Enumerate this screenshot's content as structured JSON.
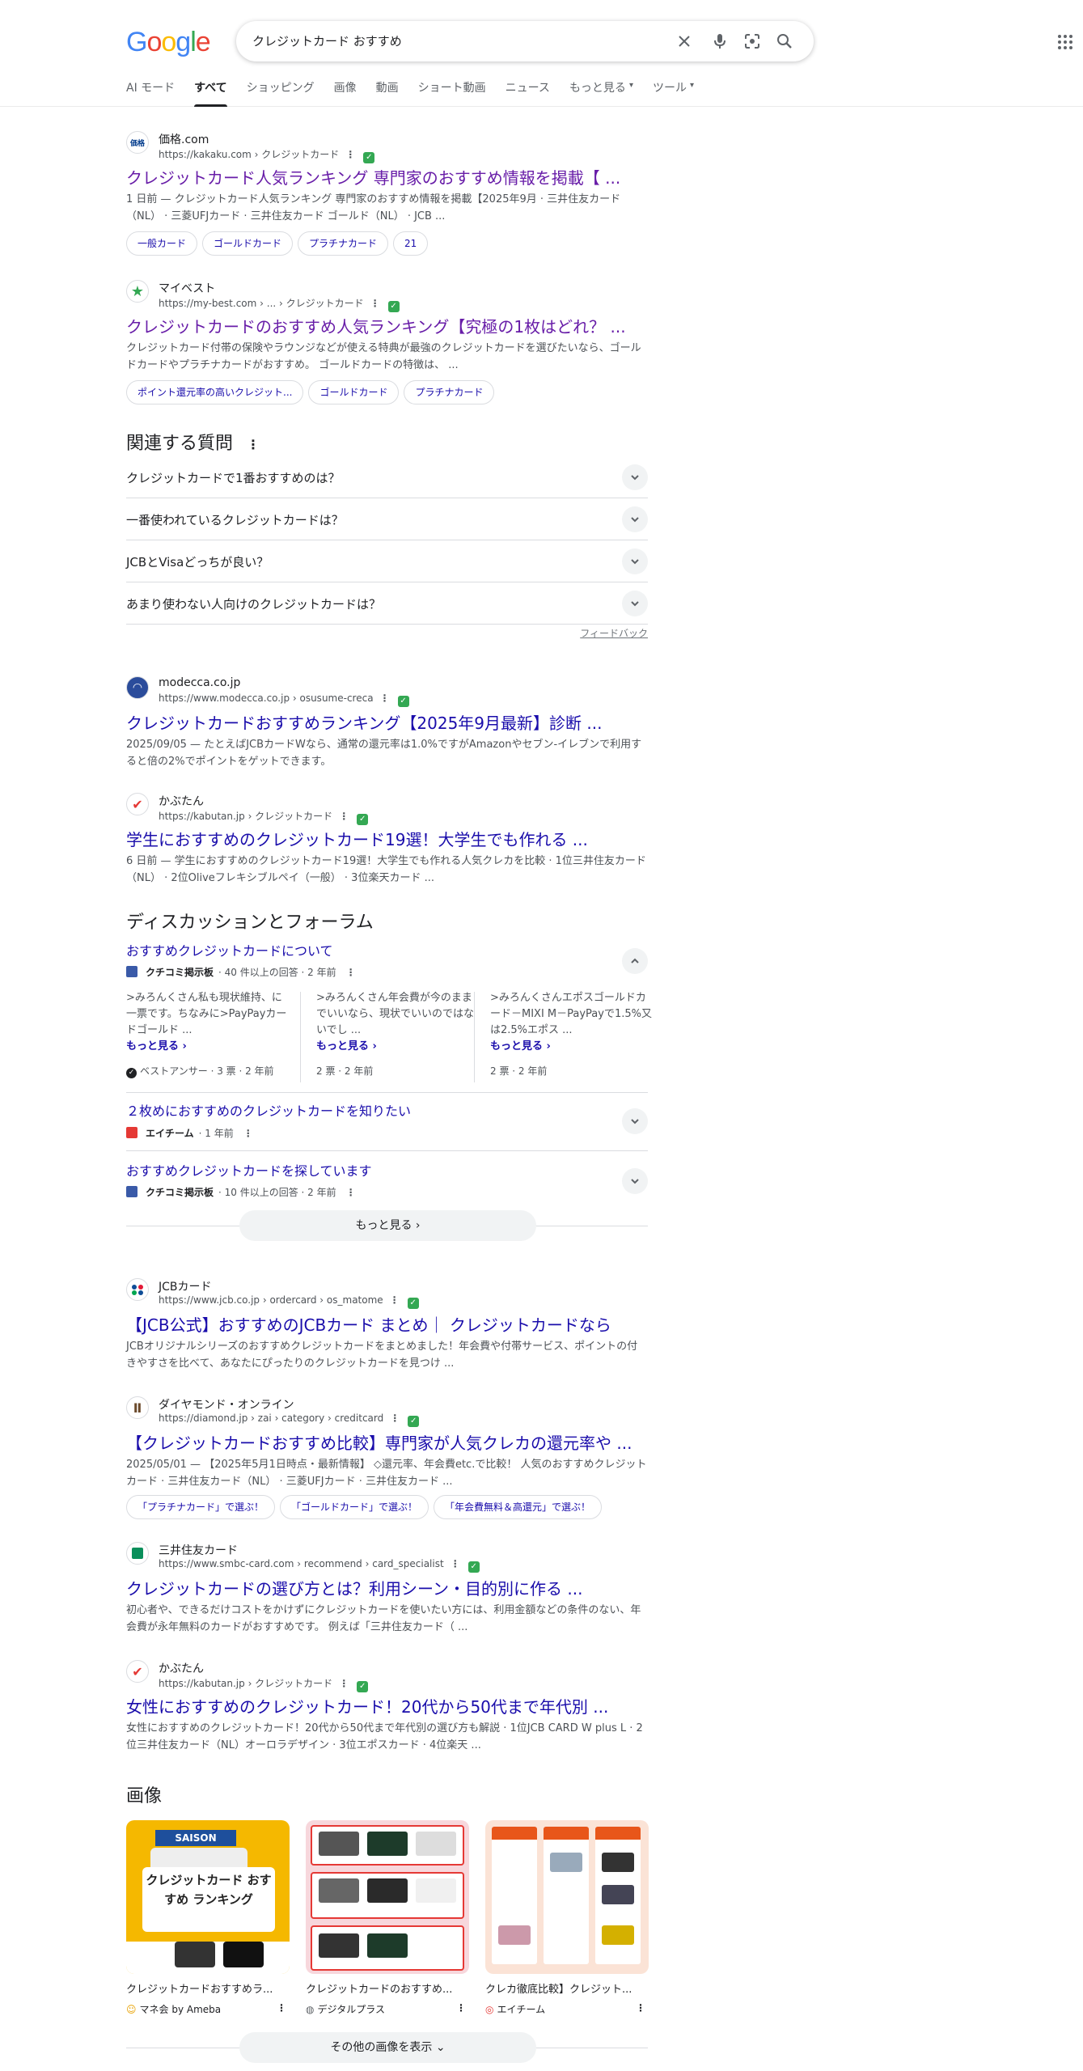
{
  "header": {
    "logo": [
      "G",
      "o",
      "o",
      "g",
      "l",
      "e"
    ],
    "logo_colors": [
      "#4285f4",
      "#ea4335",
      "#fbbc05",
      "#4285f4",
      "#34a853",
      "#ea4335"
    ],
    "query": "クレジットカード おすすめ",
    "tabs": [
      "AI モード",
      "すべて",
      "ショッピング",
      "画像",
      "動画",
      "ショート動画",
      "ニュース",
      "もっと見る",
      "ツール"
    ],
    "active_tab": "すべて"
  },
  "results_top": [
    {
      "site": "価格.com",
      "url": "https://kakaku.com › クレジットカード",
      "title": "クレジットカード人気ランキング 専門家のおすすめ情報を掲載【 ...",
      "snippet": "1 日前 — クレジットカード人気ランキング 専門家のおすすめ情報を掲載【2025年9月 · 三井住友カード（NL） · 三菱UFJカード · 三井住友カード ゴールド（NL） · JCB ...",
      "chips": [
        "一般カード",
        "ゴールドカード",
        "プラチナカード",
        "21"
      ]
    },
    {
      "site": "マイベスト",
      "url": "https://my-best.com › ... › クレジットカード",
      "title": "クレジットカードのおすすめ人気ランキング【究極の1枚はどれ？ ...",
      "snippet": "クレジットカード付帯の保険やラウンジなどが使える特典が最強のクレジットカードを選びたいなら、ゴールドカードやプラチナカードがおすすめ。 ゴールドカードの特徴は、 ...",
      "chips": [
        "ポイント還元率の高いクレジット...",
        "ゴールドカード",
        "プラチナカード"
      ]
    }
  ],
  "paa": {
    "title": "関連する質問",
    "questions": [
      "クレジットカードで1番おすすめのは？",
      "一番使われているクレジットカードは？",
      "JCBとVisaどっちが良い？",
      "あまり使わない人向けのクレジットカードは？"
    ],
    "feedback": "フィードバック"
  },
  "results_mid": [
    {
      "site": "modecca.co.jp",
      "url": "https://www.modecca.co.jp › osusume-creca",
      "title": "クレジットカードおすすめランキング【2025年9月最新】診断 ...",
      "snippet": "2025/09/05 — たとえばJCBカードWなら、通常の還元率は1.0%ですがAmazonやセブン‐イレブンで利用すると倍の2%でポイントをゲットできます。"
    },
    {
      "site": "かぶたん",
      "url": "https://kabutan.jp › クレジットカード",
      "title": "学生におすすめのクレジットカード19選！大学生でも作れる ...",
      "snippet": "6 日前 — 学生におすすめのクレジットカード19選！大学生でも作れる人気クレカを比較 · 1位三井住友カード（NL） · 2位Oliveフレキシブルペイ（一般） · 3位楽天カード ..."
    }
  ],
  "discussions": {
    "title": "ディスカッションとフォーラム",
    "threads": [
      {
        "title": "おすすめクレジットカードについて",
        "source": "クチコミ掲示板",
        "meta": "· 40 件以上の回答 · 2 年前",
        "answers": [
          {
            "text": ">みろんくさん私も現状維持、に一票です。ちなみに>PayPayカードゴールド ...",
            "more": "もっと見る ›",
            "foot": "ベストアンサー · 3 票 · 2 年前"
          },
          {
            "text": ">みろんくさん年会費が今のままでいいなら、現状でいいのではないでし ...",
            "more": "もっと見る ›",
            "foot": "2 票 · 2 年前"
          },
          {
            "text": ">みろんくさんエポスゴールドカード－MIXI M－PayPayで1.5%又は2.5%エポス ...",
            "more": "もっと見る ›",
            "foot": "2 票 · 2 年前"
          }
        ]
      },
      {
        "title": "２枚めにおすすめのクレジットカードを知りたい",
        "source": "エイチーム",
        "meta": "· 1 年前"
      },
      {
        "title": "おすすめクレジットカードを探しています",
        "source": "クチコミ掲示板",
        "meta": "· 10 件以上の回答 · 2 年前"
      }
    ],
    "more_button": "もっと見る"
  },
  "results_bottom": [
    {
      "site": "JCBカード",
      "url": "https://www.jcb.co.jp › ordercard › os_matome",
      "title": "【JCB公式】おすすめのJCBカード まとめ｜ クレジットカードなら",
      "snippet": "JCBオリジナルシリーズのおすすめクレジットカードをまとめました！年会費や付帯サービス、ポイントの付きやすさを比べて、あなたにぴったりのクレジットカードを見つけ ...",
      "chips": []
    },
    {
      "site": "ダイヤモンド・オンライン",
      "url": "https://diamond.jp › zai › category › creditcard",
      "title": "【クレジットカードおすすめ比較】専門家が人気クレカの還元率や ...",
      "snippet": "2025/05/01 — 【2025年5月1日時点・最新情報】 ◇還元率、年会費etc.で比較！ 人気のおすすめクレジットカード · 三井住友カード（NL） · 三菱UFJカード · 三井住友カード ...",
      "chips": [
        "「プラチナカード」で選ぶ！",
        "「ゴールドカード」で選ぶ！",
        "「年会費無料＆高還元」で選ぶ！"
      ]
    },
    {
      "site": "三井住友カード",
      "url": "https://www.smbc-card.com › recommend › card_specialist",
      "title": "クレジットカードの選び方とは？利用シーン・目的別に作る ...",
      "snippet": "初心者や、できるだけコストをかけずにクレジットカードを使いたい方には、利用金額などの条件のない、年会費が永年無料のカードがおすすめです。 例えば「三井住友カード（ ...",
      "chips": []
    },
    {
      "site": "かぶたん",
      "url": "https://kabutan.jp › クレジットカード",
      "title": "女性におすすめのクレジットカード！20代から50代まで年代別 ...",
      "snippet": "女性におすすめのクレジットカード！20代から50代まで年代別の選び方も解説 · 1位JCB CARD W plus L · 2位三井住友カード（NL）オーロラデザイン · 3位エポスカード · 4位楽天 ...",
      "chips": []
    }
  ],
  "images": {
    "title": "画像",
    "items": [
      {
        "caption": "クレジットカードおすすめラ...",
        "source": "マネ会 by Ameba",
        "thumb_text": "クレジットカード おすすめ ランキング",
        "thumb_top": "SAISON"
      },
      {
        "caption": "クレジットカードのおすすめ...",
        "source": "デジタルプラス",
        "thumb_text": ""
      },
      {
        "caption": "クレカ徹底比較】クレジット...",
        "source": "エイチーム",
        "thumb_text": ""
      }
    ],
    "more_button": "その他の画像を表示"
  }
}
